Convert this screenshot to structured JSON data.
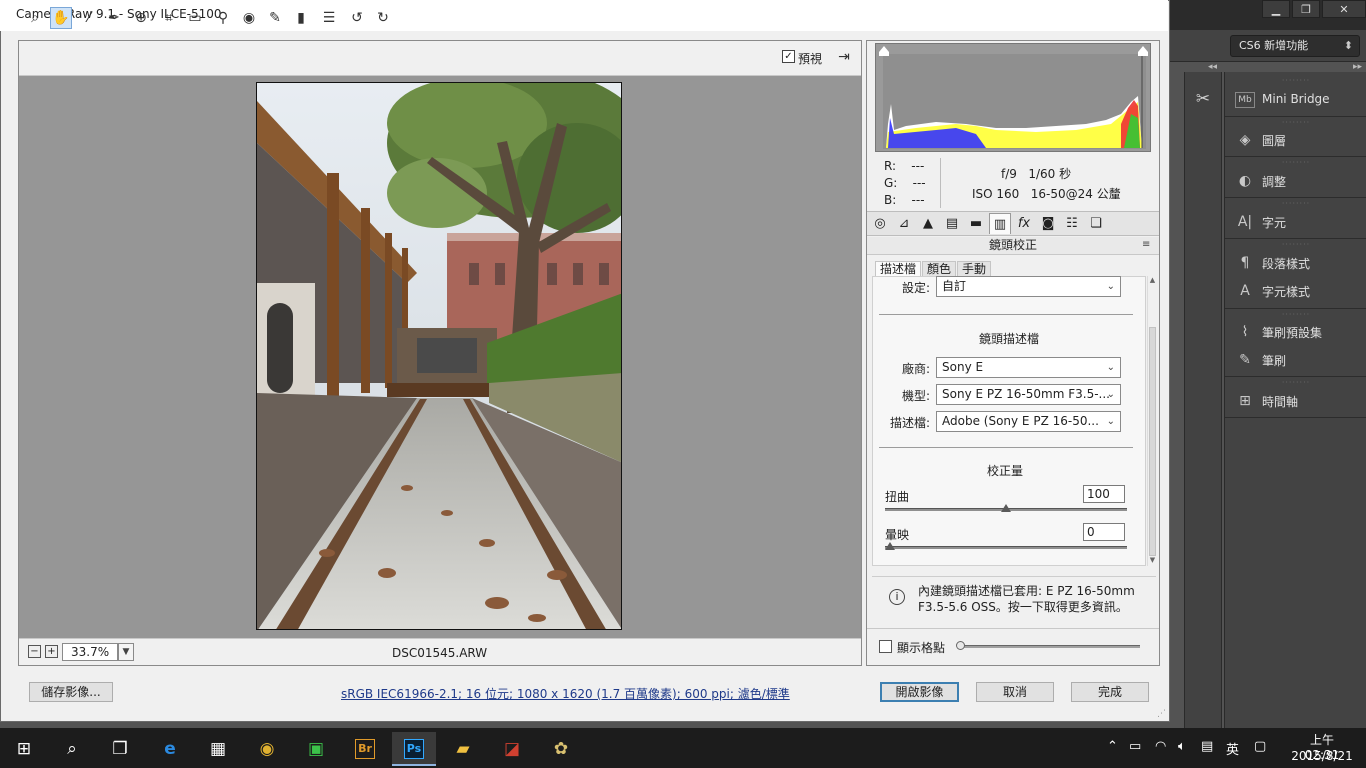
{
  "dialog": {
    "title": "Camera Raw 9.1  -  Sony ILCE-5100",
    "preview_label": "預視",
    "preview_checked": true,
    "zoom_value": "33.7%",
    "filename": "DSC01545.ARW"
  },
  "toolbar_icons": [
    "zoom-icon",
    "hand-icon",
    "white-balance-icon",
    "color-sampler-icon",
    "target-adjust-icon",
    "crop-icon",
    "straighten-icon",
    "spot-removal-icon",
    "red-eye-icon",
    "adjustment-brush-icon",
    "graduated-filter-icon",
    "preferences-icon",
    "rotate-ccw-icon",
    "rotate-cw-icon"
  ],
  "readout": {
    "r_label": "R:",
    "g_label": "G:",
    "b_label": "B:",
    "r_value": "---",
    "g_value": "---",
    "b_value": "---",
    "aperture": "f/9",
    "shutter": "1/60 秒",
    "iso": "ISO 160",
    "lens_focal": "16-50@24 公釐"
  },
  "panel": {
    "section_title": "鏡頭校正",
    "subtabs": [
      "描述檔",
      "顏色",
      "手動"
    ],
    "active_subtab": "描述檔",
    "setup_label": "設定:",
    "setup_value": "自訂",
    "lens_profile_heading": "鏡頭描述檔",
    "make_label": "廠商:",
    "make_value": "Sony E",
    "model_label": "機型:",
    "model_value": "Sony E PZ 16-50mm F3.5-...",
    "profile_label": "描述檔:",
    "profile_value": "Adobe (Sony E PZ 16-50...",
    "amount_heading": "校正量",
    "distortion_label": "扭曲",
    "distortion_value": "100",
    "vignetting_label": "暈映",
    "vignetting_value": "0",
    "distortion_fraction": 0.5,
    "vignetting_fraction": 0.0,
    "info_text": "內建鏡頭描述檔已套用: E PZ 16-50mm F3.5-5.6 OSS。按一下取得更多資訊。",
    "grid_label": "顯示格點"
  },
  "buttons": {
    "save": "儲存影像...",
    "open": "開啟影像",
    "cancel": "取消",
    "done": "完成"
  },
  "workflow_link": "sRGB IEC61966-2.1; 16 位元; 1080 x 1620 (1.7 百萬像素); 600 ppi; 濾色/標準",
  "photoshop": {
    "workspace": "CS6 新增功能",
    "panels": [
      {
        "icon": "mini-bridge-icon",
        "label": "Mini Bridge"
      },
      {
        "icon": "layers-icon",
        "label": "圖層"
      },
      {
        "icon": "adjustments-icon",
        "label": "調整"
      },
      {
        "icon": "character-icon",
        "label": "字元"
      },
      {
        "icon": "paragraph-styles-icon",
        "label": "段落樣式"
      },
      {
        "icon": "character-styles-icon",
        "label": "字元樣式"
      },
      {
        "icon": "brush-presets-icon",
        "label": "筆刷預設集"
      },
      {
        "icon": "brush-icon",
        "label": "筆刷"
      },
      {
        "icon": "timeline-icon",
        "label": "時間軸"
      }
    ]
  },
  "taskbar": {
    "time": "上午 02:31",
    "date": "2015/8/21",
    "ime": "英",
    "apps": [
      "start-icon",
      "search-icon",
      "task-view-icon",
      "edge-icon",
      "store-icon",
      "chrome-icon",
      "line-icon",
      "bridge-icon",
      "photoshop-icon",
      "explorer-icon",
      "app-icon",
      "paint-icon"
    ],
    "bridge_label": "Br",
    "photoshop_label": "Ps"
  },
  "colors": {
    "accent": "#3c7fb1",
    "link": "#1f3a8a",
    "taskbar": "#1c1c1c",
    "ps_panel": "#434343"
  }
}
